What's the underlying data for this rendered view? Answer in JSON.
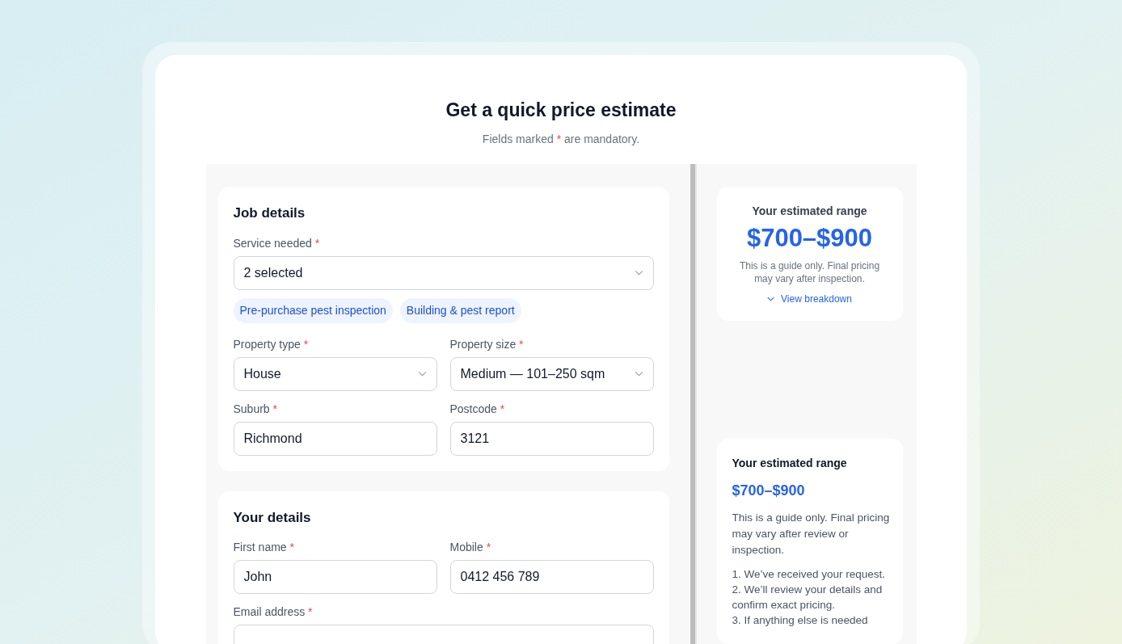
{
  "header": {
    "title": "Get a quick price estimate",
    "subtitle": {
      "before": "Fields marked",
      "mark": "*",
      "after": "are mandatory."
    }
  },
  "sections": [
    {
      "title": "Job details",
      "rows": [
        {
          "fields": [
            {
              "kind": "select",
              "label": "Service needed",
              "asterisk": "*",
              "value": "2 selected"
            }
          ]
        },
        {
          "chips": [
            "Pre-purchase pest inspection",
            "Building & pest report"
          ]
        },
        {
          "fields": [
            {
              "kind": "select",
              "label": "Property type",
              "asterisk": "*",
              "value": "House"
            },
            {
              "kind": "select",
              "label": "Property size",
              "asterisk": "*",
              "value": "Medium — 101–250 sqm"
            }
          ]
        },
        {
          "fields": [
            {
              "kind": "text",
              "label": "Suburb",
              "asterisk": "*",
              "value": "Richmond"
            },
            {
              "kind": "text",
              "label": "Postcode",
              "asterisk": "*",
              "value": "3121"
            }
          ]
        }
      ]
    },
    {
      "title": "Your details",
      "rows": [
        {
          "fields": [
            {
              "kind": "text",
              "label": "First name",
              "asterisk": "*",
              "value": "John"
            },
            {
              "kind": "text",
              "label": "Mobile",
              "asterisk": "*",
              "value": "0412 456 789"
            }
          ]
        },
        {
          "fields": [
            {
              "kind": "text",
              "label": "Email address",
              "asterisk": "*"
            }
          ]
        }
      ]
    }
  ],
  "summary": {
    "heading": "Your estimated range",
    "range": "$700–$900",
    "note": "This is a guide only. Final pricing may vary after inspection.",
    "link": {
      "label": "View breakdown",
      "expanded": false
    }
  },
  "confirmation": {
    "heading": "Your estimated range",
    "range": "$700–$900",
    "note": "This is a guide only. Final pricing may vary after review or inspection.",
    "steps": [
      "1. We’ve received your request.",
      "2. We’ll review your details and confirm exact pricing.",
      "3. If anything else is needed"
    ]
  }
}
